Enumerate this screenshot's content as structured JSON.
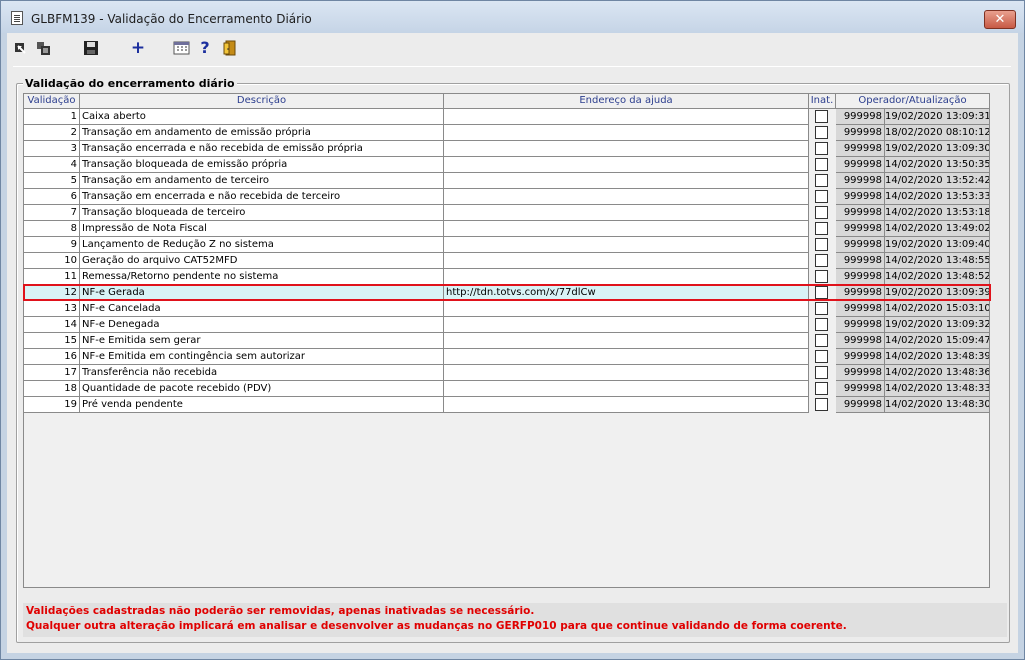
{
  "window": {
    "title": "GLBFM139 - Validação do Encerramento Diário",
    "close_label": "✕"
  },
  "toolbar": {
    "icons": [
      "exit-back-icon",
      "copy-icon",
      "save-icon",
      "add-icon",
      "calendar-icon",
      "help-icon",
      "door-exit-icon"
    ],
    "add_glyph": "+",
    "help_glyph": "?"
  },
  "group": {
    "legend": "Validação do encerramento diário"
  },
  "table": {
    "headers": {
      "num": "Validação",
      "desc": "Descrição",
      "url": "Endereço da ajuda",
      "inat": "Inat.",
      "op": "Operador/Atualização"
    },
    "rows": [
      {
        "num": "1",
        "desc": "Caixa aberto",
        "url": "",
        "op": "999998",
        "dt": "19/02/2020 13:09:31"
      },
      {
        "num": "2",
        "desc": "Transação em andamento de emissão própria",
        "url": "",
        "op": "999998",
        "dt": "18/02/2020 08:10:12"
      },
      {
        "num": "3",
        "desc": "Transação encerrada e não recebida de emissão própria",
        "url": "",
        "op": "999998",
        "dt": "19/02/2020 13:09:30"
      },
      {
        "num": "4",
        "desc": "Transação bloqueada de emissão própria",
        "url": "",
        "op": "999998",
        "dt": "14/02/2020 13:50:35"
      },
      {
        "num": "5",
        "desc": "Transação em andamento de terceiro",
        "url": "",
        "op": "999998",
        "dt": "14/02/2020 13:52:42"
      },
      {
        "num": "6",
        "desc": "Transação em encerrada e não recebida de terceiro",
        "url": "",
        "op": "999998",
        "dt": "14/02/2020 13:53:33"
      },
      {
        "num": "7",
        "desc": "Transação bloqueada de terceiro",
        "url": "",
        "op": "999998",
        "dt": "14/02/2020 13:53:18"
      },
      {
        "num": "8",
        "desc": "Impressão de Nota Fiscal",
        "url": "",
        "op": "999998",
        "dt": "14/02/2020 13:49:02"
      },
      {
        "num": "9",
        "desc": "Lançamento de Redução Z no sistema",
        "url": "",
        "op": "999998",
        "dt": "19/02/2020 13:09:40"
      },
      {
        "num": "10",
        "desc": "Geração do arquivo CAT52MFD",
        "url": "",
        "op": "999998",
        "dt": "14/02/2020 13:48:55"
      },
      {
        "num": "11",
        "desc": "Remessa/Retorno pendente no sistema",
        "url": "",
        "op": "999998",
        "dt": "14/02/2020 13:48:52"
      },
      {
        "num": "12",
        "desc": "NF-e Gerada",
        "url": "http://tdn.totvs.com/x/77dlCw",
        "op": "999998",
        "dt": "19/02/2020 13:09:39"
      },
      {
        "num": "13",
        "desc": "NF-e Cancelada",
        "url": "",
        "op": "999998",
        "dt": "14/02/2020 15:03:10"
      },
      {
        "num": "14",
        "desc": "NF-e Denegada",
        "url": "",
        "op": "999998",
        "dt": "19/02/2020 13:09:32"
      },
      {
        "num": "15",
        "desc": "NF-e Emitida sem gerar",
        "url": "",
        "op": "999998",
        "dt": "14/02/2020 15:09:47"
      },
      {
        "num": "16",
        "desc": "NF-e Emitida em contingência sem autorizar",
        "url": "",
        "op": "999998",
        "dt": "14/02/2020 13:48:39"
      },
      {
        "num": "17",
        "desc": "Transferência não recebida",
        "url": "",
        "op": "999998",
        "dt": "14/02/2020 13:48:36"
      },
      {
        "num": "18",
        "desc": "Quantidade de pacote recebido (PDV)",
        "url": "",
        "op": "999998",
        "dt": "14/02/2020 13:48:33"
      },
      {
        "num": "19",
        "desc": "Pré venda pendente",
        "url": "",
        "op": "999998",
        "dt": "14/02/2020 13:48:30"
      }
    ]
  },
  "note": {
    "line1": "Validações cadastradas não poderão ser removidas, apenas inativadas se necessário.",
    "line2": "Qualquer outra alteração implicará em analisar e desenvolver as mudanças no GERFP010 para que continue validando de forma coerente."
  },
  "colors": {
    "accent_header": "#2c3e8e",
    "warning_text": "#e00000",
    "selection_border": "#e0121b",
    "selection_fill": "#d9f3f6"
  }
}
